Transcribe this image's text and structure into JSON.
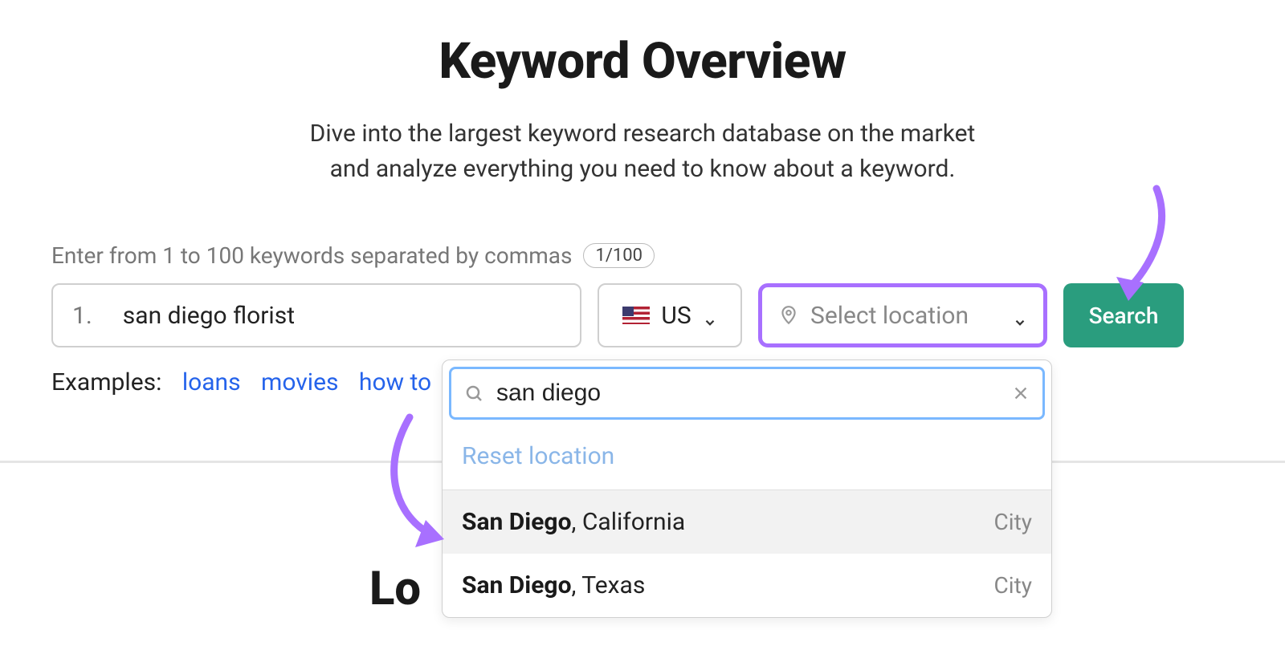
{
  "header": {
    "title": "Keyword Overview",
    "subtitle_line1": "Dive into the largest keyword research database on the market",
    "subtitle_line2": "and analyze everything you need to know about a keyword."
  },
  "input": {
    "helper_text": "Enter from 1 to 100 keywords separated by commas",
    "counter": "1/100",
    "index": "1.",
    "value": "san diego florist"
  },
  "country": {
    "label": "US"
  },
  "location": {
    "placeholder": "Select location"
  },
  "search_button": "Search",
  "examples": {
    "label": "Examples:",
    "items": [
      "loans",
      "movies",
      "how to"
    ]
  },
  "dropdown": {
    "search_value": "san diego",
    "reset_label": "Reset location",
    "results": [
      {
        "bold": "San Diego",
        "rest": ", California",
        "type": "City",
        "highlight": true
      },
      {
        "bold": "San Diego",
        "rest": ", Texas",
        "type": "City",
        "highlight": false
      }
    ]
  },
  "partial_heading": "Lo"
}
